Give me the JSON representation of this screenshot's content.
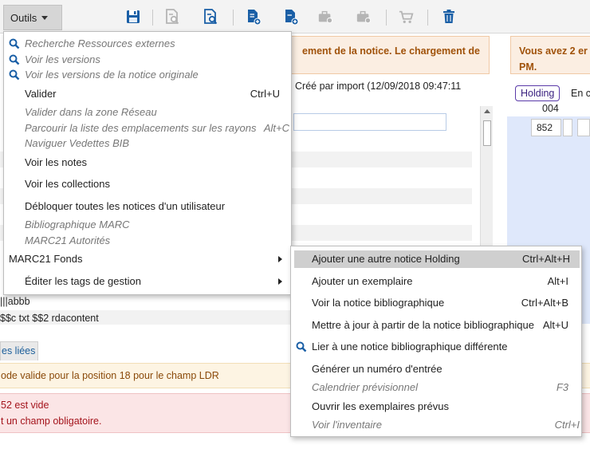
{
  "toolbar": {
    "outils_label": "Outils",
    "icons": [
      "save-icon",
      "search-doc-icon",
      "search-doc-blue-icon",
      "add-doc-icon",
      "add-doc-2-icon",
      "briefcase-add-icon",
      "briefcase-icon",
      "cart-icon",
      "trash-icon"
    ]
  },
  "background": {
    "notice_warning_left": "ement de la notice. Le chargement de",
    "notice_warning_right": "Vous avez 2 er",
    "notice_warning_right_2": "PM.",
    "created_by": "Créé par import (12/09/2018 09:47:11",
    "holding_badge": "Holding",
    "holding_tab": "En c",
    "field_004": "004",
    "field_852": "852",
    "row_abbb": "|||abbb",
    "row_rdacontent": "$$c txt $$2 rdacontent",
    "tab_liees": "es liées",
    "alert_orange": "ode valide pour la position 18 pour le champ LDR",
    "alert_red_1": "52 est vide",
    "alert_red_2": "t un champ obligatoire."
  },
  "menu": {
    "items": [
      {
        "label": "Recherche Ressources externes",
        "icon": "search-icon"
      },
      {
        "label": "Voir les versions",
        "icon": "search-icon"
      },
      {
        "label": "Voir les versions de la notice originale",
        "icon": "search-icon"
      },
      {
        "label": "Valider",
        "shortcut": "Ctrl+U"
      },
      {
        "label": "Valider dans la zone Réseau"
      },
      {
        "label": "Parcourir la liste des emplacements sur les rayons",
        "shortcut": "Alt+C"
      },
      {
        "label": "Naviguer Vedettes BIB"
      },
      {
        "label": "Voir les notes"
      },
      {
        "label": "Voir les collections"
      },
      {
        "label": "Débloquer toutes les notices d'un utilisateur"
      },
      {
        "label": "Bibliographique MARC"
      },
      {
        "label": "MARC21 Autorités"
      },
      {
        "label": "MARC21 Fonds"
      },
      {
        "label": "Éditer les tags de gestion"
      }
    ]
  },
  "submenu": {
    "items": [
      {
        "label": "Ajouter une autre notice Holding",
        "shortcut": "Ctrl+Alt+H"
      },
      {
        "label": "Ajouter un exemplaire",
        "shortcut": "Alt+I"
      },
      {
        "label": "Voir la notice bibliographique",
        "shortcut": "Ctrl+Alt+B"
      },
      {
        "label": "Mettre à jour à partir de la notice bibliographique",
        "shortcut": "Alt+U"
      },
      {
        "label": "Lier à une notice bibliographique différente",
        "icon": "search-icon"
      },
      {
        "label": "Générer un numéro d'entrée"
      },
      {
        "label": "Calendrier prévisionnel",
        "shortcut": "F3"
      },
      {
        "label": "Ouvrir les exemplaires prévus"
      },
      {
        "label": "Voir l'inventaire",
        "shortcut": "Ctrl+I"
      }
    ]
  },
  "colors": {
    "accent_blue": "#1a5fa6",
    "warning_orange": "#a0520a",
    "error_red": "#a4141c"
  }
}
